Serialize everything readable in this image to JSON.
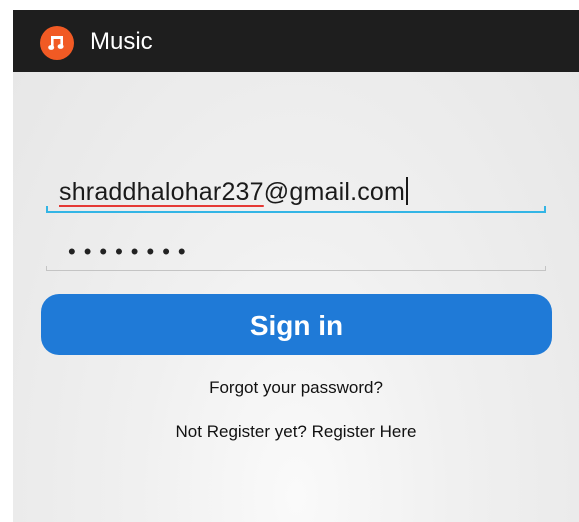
{
  "app_bar": {
    "title": "Music",
    "icon": "music-note-icon",
    "background": "#1e1e1e",
    "icon_color": "#f15a24"
  },
  "login_form": {
    "email": {
      "value_misspelled_part": "shraddhalohar237",
      "value_rest": "@gmail.com"
    },
    "password": {
      "masked_value": "••••••••"
    },
    "sign_in_label": "Sign in",
    "sign_in_color": "#1f7ad7",
    "focus_color": "#33b5e5",
    "forgot_password_label": "Forgot your password?",
    "register_label": "Not Register yet? Register Here"
  }
}
